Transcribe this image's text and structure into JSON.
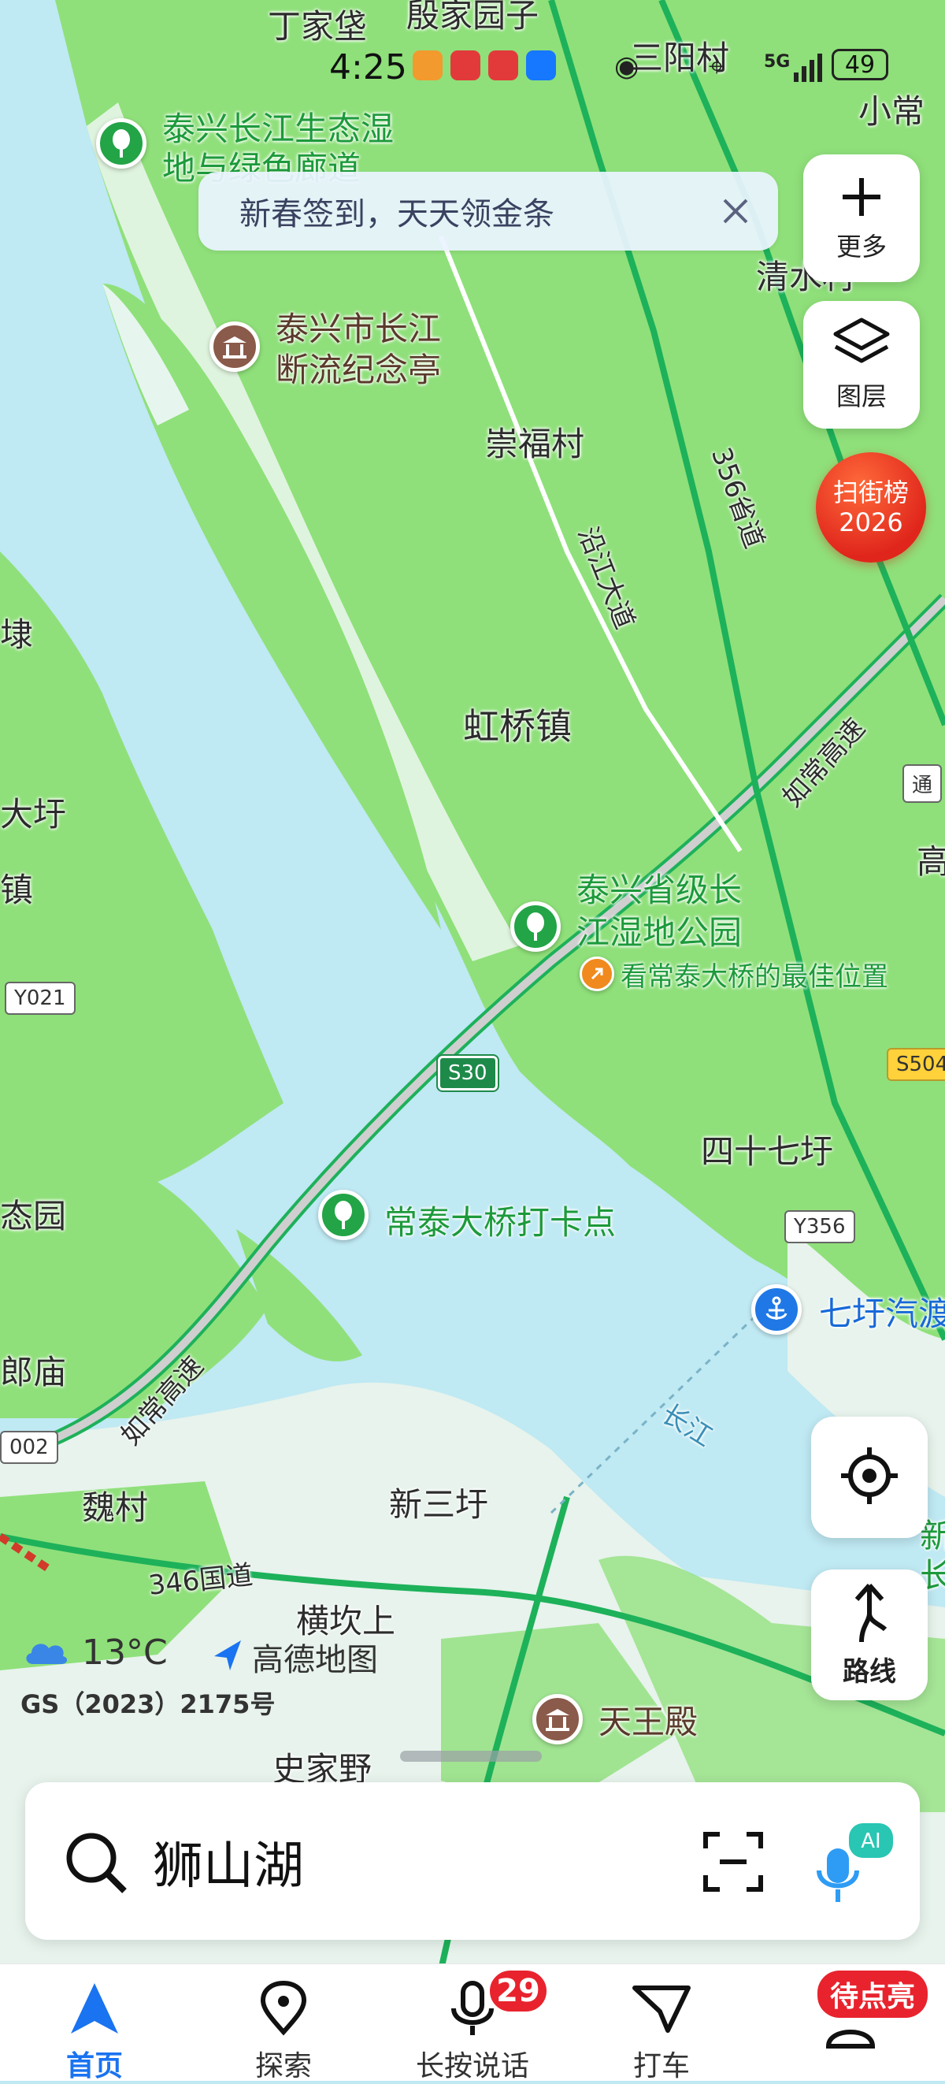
{
  "status_bar": {
    "time": "4:25",
    "battery": "49",
    "network": "5G"
  },
  "banner": {
    "text": "新春签到，天天领金条"
  },
  "map_labels": {
    "dingjiaba": "丁家垡",
    "yinjia": "殷家园子",
    "sanyang": "三阳村",
    "xiaochang": "小常",
    "wetland_corridor_1": "泰兴长江生态湿",
    "wetland_corridor_2": "地与绿色廊道",
    "qingshui": "清水村",
    "monument_1": "泰兴市长江",
    "monument_2": "断流纪念亭",
    "chongfu": "崇福村",
    "road_356": "356省道",
    "yanjiang": "沿江大道",
    "li": "埭",
    "hongqiao": "虹桥镇",
    "rc_highway_1": "如常高速",
    "tong": "通",
    "dayu": "大圩",
    "zhen": "镇",
    "gao": "高",
    "park_1": "泰兴省级长",
    "park_2": "江湿地公园",
    "best_view": "看常泰大桥的最佳位置",
    "y021": "Y021",
    "s30": "S30",
    "s504": "S504",
    "sishiqi": "四十七圩",
    "taiyuan": "态园",
    "checkin": "常泰大桥打卡点",
    "y356": "Y356",
    "qiyu_ferry": "七圩汽渡",
    "langmiao": "郎庙",
    "rc_highway_2": "如常高速",
    "changjiang": "长江",
    "road_002": "002",
    "weicun": "魏村",
    "xinsanyu": "新三圩",
    "road_346": "346国道",
    "hengkanshang": "横坎上",
    "shijiaye": "史家野",
    "tianwang": "天王殿",
    "xin": "新",
    "chang": "长"
  },
  "weather": {
    "temp": "13°C"
  },
  "brand": "高德地图",
  "license": "GS（2023）2175号",
  "controls": {
    "more_label": "更多",
    "layers_label": "图层",
    "route_label": "路线"
  },
  "scan_badge": {
    "line1": "扫街榜",
    "line2": "2026"
  },
  "search": {
    "placeholder": "狮山湖"
  },
  "tabbar": {
    "home": "首页",
    "explore": "探索",
    "voice": "长按说话",
    "voice_badge": "29",
    "taxi": "打车",
    "mine_badge": "待点亮"
  },
  "colors": {
    "accent": "#1a73f0",
    "water": "#bfe9f3",
    "land": "#8fe07a",
    "badge_red": "#e8232e"
  }
}
